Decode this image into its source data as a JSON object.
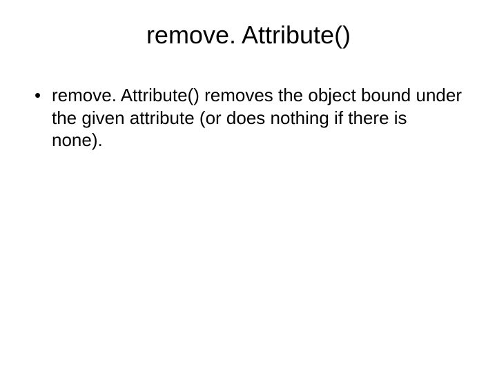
{
  "slide": {
    "title": "remove. Attribute()",
    "bullets": [
      {
        "text": "remove. Attribute() removes the object bound under the given attribute (or does nothing if there is none)."
      }
    ]
  }
}
